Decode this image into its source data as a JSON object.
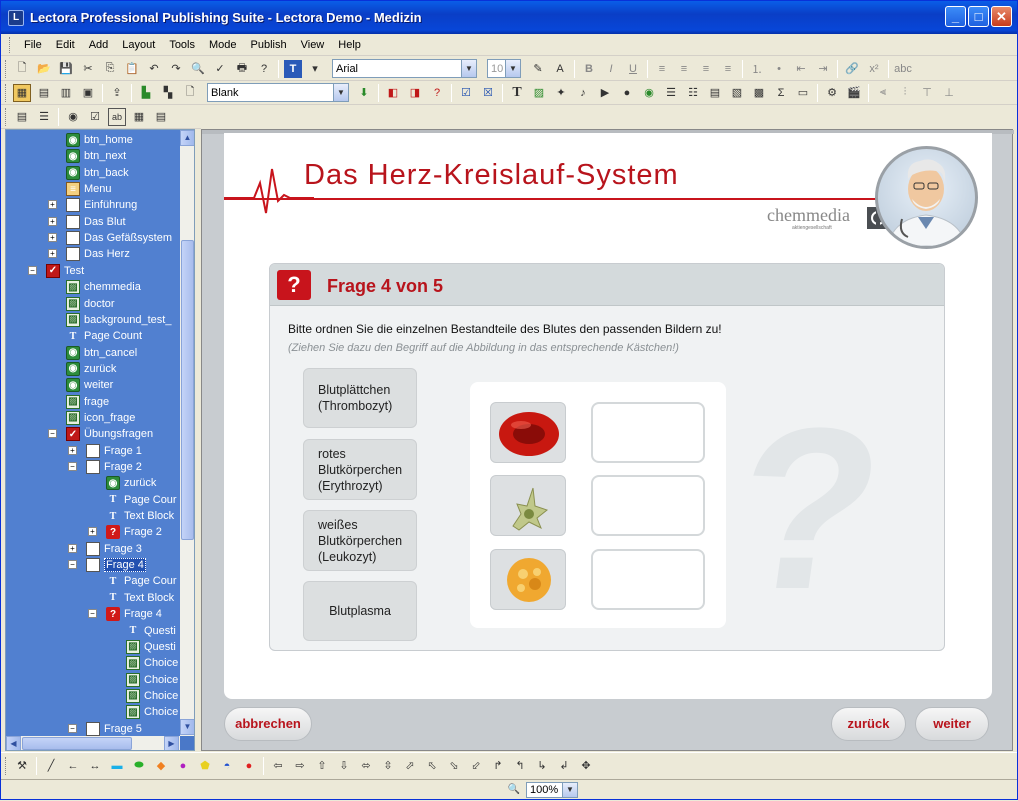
{
  "window": {
    "title": "Lectora Professional Publishing Suite - Lectora Demo - Medizin",
    "minimize": "_",
    "maximize": "□",
    "close": "✕"
  },
  "menu": [
    "File",
    "Edit",
    "Add",
    "Layout",
    "Tools",
    "Mode",
    "Publish",
    "View",
    "Help"
  ],
  "toolbar": {
    "font_name": "Arial",
    "font_size": "10",
    "layout_template": "Blank"
  },
  "tree": {
    "items": [
      {
        "label": "btn_home",
        "icon": "button-icon"
      },
      {
        "label": "btn_next",
        "icon": "button-icon"
      },
      {
        "label": "btn_back",
        "icon": "button-icon"
      },
      {
        "label": "Menu",
        "icon": "menu-icon"
      },
      {
        "label": "Einführung",
        "icon": "page-icon"
      },
      {
        "label": "Das Blut",
        "icon": "page-icon"
      },
      {
        "label": "Das Gefäßsystem",
        "icon": "page-icon"
      },
      {
        "label": "Das Herz",
        "icon": "page-icon"
      },
      {
        "label": "Test",
        "icon": "test-icon"
      },
      {
        "label": "chemmedia",
        "icon": "image-icon"
      },
      {
        "label": "doctor",
        "icon": "image-icon"
      },
      {
        "label": "background_test_",
        "icon": "image-icon"
      },
      {
        "label": "Page Count",
        "icon": "text-icon"
      },
      {
        "label": "btn_cancel",
        "icon": "button-icon"
      },
      {
        "label": "zurück",
        "icon": "button-icon"
      },
      {
        "label": "weiter",
        "icon": "button-icon"
      },
      {
        "label": "frage",
        "icon": "image-icon"
      },
      {
        "label": "icon_frage",
        "icon": "image-icon"
      },
      {
        "label": "Übungsfragen",
        "icon": "test-icon"
      },
      {
        "label": "Frage 1",
        "icon": "page-icon"
      },
      {
        "label": "Frage 2",
        "icon": "page-icon"
      },
      {
        "label": "zurück",
        "icon": "button-icon"
      },
      {
        "label": "Page Cour",
        "icon": "text-icon"
      },
      {
        "label": "Text Block",
        "icon": "text-icon"
      },
      {
        "label": "Frage 2",
        "icon": "question-icon"
      },
      {
        "label": "Frage 3",
        "icon": "page-icon"
      },
      {
        "label": "Frage 4",
        "icon": "page-icon"
      },
      {
        "label": "Page Cour",
        "icon": "text-icon"
      },
      {
        "label": "Text Block",
        "icon": "text-icon"
      },
      {
        "label": "Frage 4",
        "icon": "question-icon"
      },
      {
        "label": "Questi",
        "icon": "text-icon"
      },
      {
        "label": "Questi",
        "icon": "image-icon"
      },
      {
        "label": "Choice",
        "icon": "image-icon"
      },
      {
        "label": "Choice",
        "icon": "image-icon"
      },
      {
        "label": "Choice",
        "icon": "image-icon"
      },
      {
        "label": "Choice",
        "icon": "image-icon"
      },
      {
        "label": "Frage 5",
        "icon": "page-icon"
      }
    ]
  },
  "page": {
    "course_title": "Das Herz-Kreislauf-System",
    "brand": "chemmedia",
    "brand_sub": "aktiengesellschaft",
    "question_header": "Frage 4 von 5",
    "question_icon": "?",
    "question_text": "Bitte ordnen Sie die einzelnen Bestandteile des Blutes den passenden Bildern zu!",
    "hint": "(Ziehen Sie dazu den Begriff auf die Abbildung in das entsprechende Kästchen!)",
    "terms": [
      "Blutplättchen\n(Thrombozyt)",
      "rotes\nBlutkörperchen\n(Erythrozyt)",
      "weißes\nBlutkörperchen\n(Leukozyt)",
      "Blutplasma"
    ],
    "buttons": {
      "cancel": "abbrechen",
      "back": "zurück",
      "next": "weiter"
    },
    "big_mark": "?"
  },
  "status": {
    "zoom": "100%"
  },
  "colors": {
    "accent_red": "#b8141c",
    "tree_bg": "#5180d0",
    "title_blue": "#0a4ed8"
  }
}
